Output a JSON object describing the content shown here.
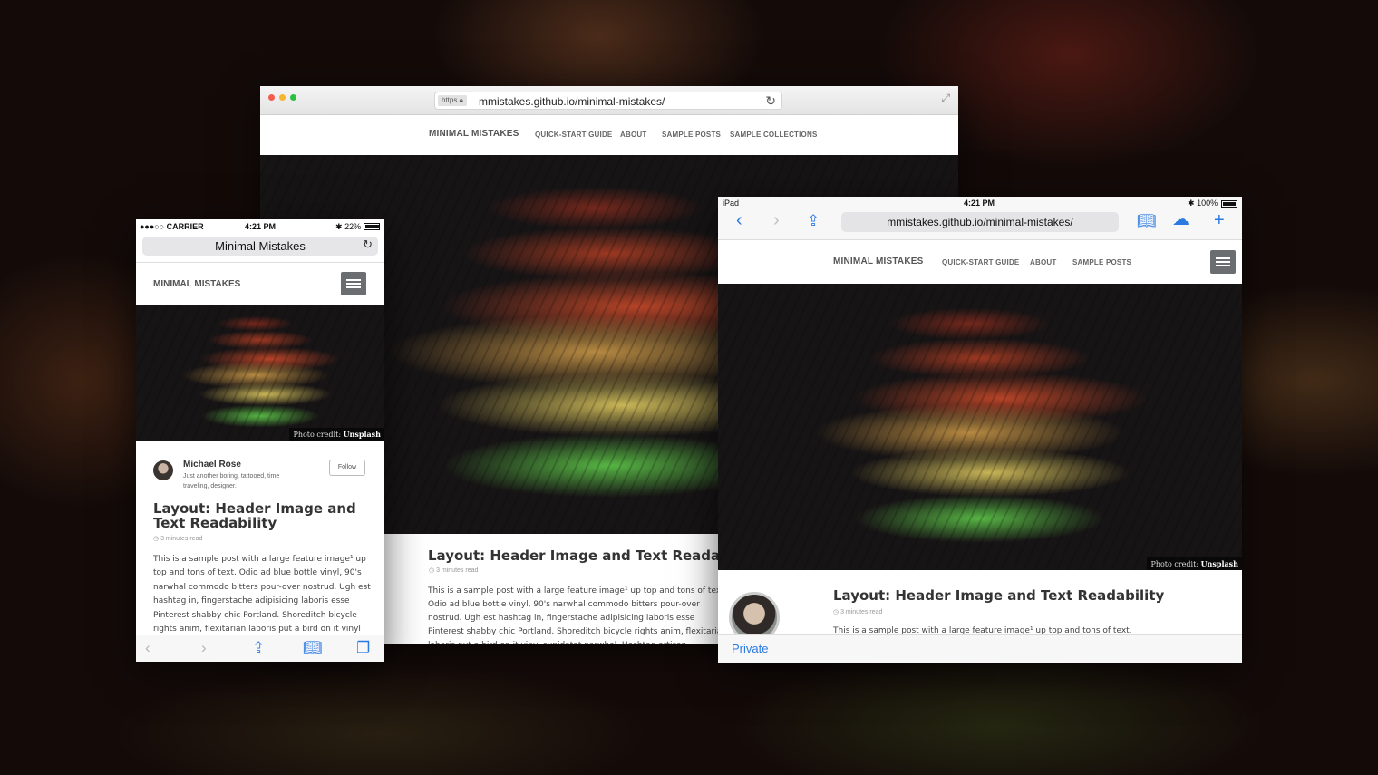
{
  "desktop": {
    "url_badge": "https",
    "url": "mmistakes.github.io/minimal-mistakes/",
    "nav": {
      "brand": "MINIMAL MISTAKES",
      "items": [
        "QUICK-START GUIDE",
        "ABOUT",
        "SAMPLE POSTS",
        "SAMPLE COLLECTIONS"
      ]
    },
    "post": {
      "title": "Layout: Header Image and Text Readability",
      "read_time": "3 minutes read",
      "body": "This is a sample post with a large feature image¹ up top and tons of text. Odio ad blue bottle vinyl, 90's narwhal commodo bitters pour-over nostrud. Ugh est hashtag in, fingerstache adipisicing laboris esse Pinterest shabby chic Portland. Shoreditch bicycle rights anim, flexitarian laboris put a bird on it vinyl cupidatat narwhal. Hashtag artisan skateboard"
    }
  },
  "phone": {
    "status": {
      "carrier": "●●●○○ CARRIER",
      "time": "4:21 PM",
      "battery": "22%"
    },
    "url_title": "Minimal Mistakes",
    "nav_brand": "MINIMAL MISTAKES",
    "photo_credit_label": "Photo credit:",
    "photo_credit_source": "Unsplash",
    "author": {
      "name": "Michael Rose",
      "bio": "Just another boring, tattooed, time traveling, designer.",
      "follow_label": "Follow"
    },
    "post": {
      "title": "Layout: Header Image and Text Readability",
      "read_time": "3 minutes read",
      "body": "This is a sample post with a large feature image¹ up top and tons of text. Odio ad blue bottle vinyl, 90's narwhal commodo bitters pour-over nostrud. Ugh est hashtag in, fingerstache adipisicing laboris esse Pinterest shabby chic Portland. Shoreditch bicycle rights anim, flexitarian laboris put a bird on it vinyl"
    }
  },
  "ipad": {
    "status": {
      "device": "iPad",
      "time": "4:21 PM",
      "battery": "100%"
    },
    "url": "mmistakes.github.io/minimal-mistakes/",
    "nav": {
      "brand": "MINIMAL MISTAKES",
      "items": [
        "QUICK-START GUIDE",
        "ABOUT",
        "SAMPLE POSTS"
      ]
    },
    "photo_credit_label": "Photo credit:",
    "photo_credit_source": "Unsplash",
    "post": {
      "title": "Layout: Header Image and Text Readability",
      "read_time": "3 minutes read",
      "body": "This is a sample post with a large feature image¹ up top and tons of text."
    },
    "private_label": "Private"
  },
  "colors": {
    "accent_blue": "#2a7ae2",
    "hamburger_gray": "#6b6e71",
    "traffic_red": "#f35b4f",
    "traffic_yellow": "#f6b52e",
    "traffic_green": "#2cc13e"
  }
}
